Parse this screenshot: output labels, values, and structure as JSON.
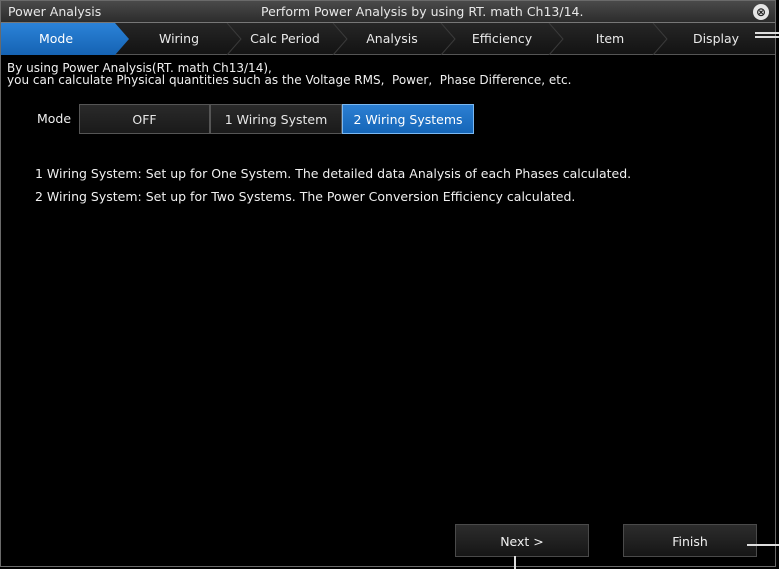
{
  "window": {
    "title": "Power Analysis",
    "subtitle": "Perform Power Analysis by using RT. math Ch13/14.",
    "close_icon": "⊗"
  },
  "tabs": [
    {
      "label": "Mode",
      "active": true
    },
    {
      "label": "Wiring",
      "active": false
    },
    {
      "label": "Calc Period",
      "active": false
    },
    {
      "label": "Analysis",
      "active": false
    },
    {
      "label": "Efficiency",
      "active": false
    },
    {
      "label": "Item",
      "active": false
    },
    {
      "label": "Display",
      "active": false
    }
  ],
  "description": {
    "line1": "By using Power Analysis(RT. math Ch13/14),",
    "line2": "you can calculate Physical quantities such as the Voltage RMS,  Power,  Phase Difference, etc."
  },
  "mode": {
    "label": "Mode",
    "options": [
      "OFF",
      "1 Wiring System",
      "2 Wiring Systems"
    ],
    "selected": "2 Wiring Systems"
  },
  "info": {
    "line1": "1 Wiring System: Set up for One System. The detailed data Analysis of each Phases calculated.",
    "line2": "2 Wiring System: Set up for Two Systems. The Power Conversion Efficiency calculated."
  },
  "footer": {
    "next_label": "Next >",
    "finish_label": "Finish"
  },
  "colors": {
    "accent": "#1e72c6",
    "accent_border": "#7ab8f2",
    "background": "#000000"
  }
}
